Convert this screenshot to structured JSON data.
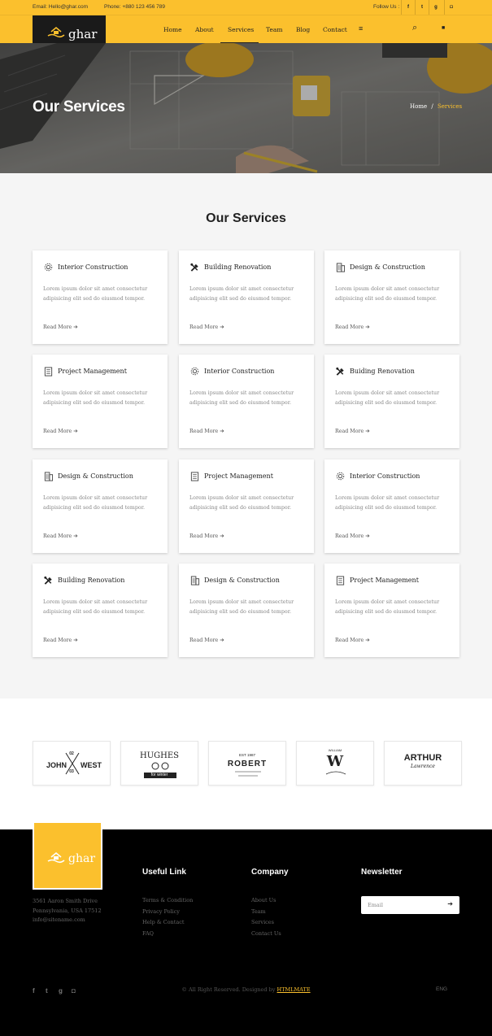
{
  "topbar": {
    "email": "Email: Hello@ghar.com",
    "phone": "Phone: +880 123 456 789",
    "follow": "Follow Us :",
    "social": [
      {
        "icon": "facebook-icon",
        "glyph": "f"
      },
      {
        "icon": "twitter-icon",
        "glyph": "t"
      },
      {
        "icon": "google-plus-icon",
        "glyph": "g"
      },
      {
        "icon": "instagram-icon",
        "glyph": "◘"
      }
    ]
  },
  "brand": {
    "name": "ghar"
  },
  "nav": {
    "items": [
      "Home",
      "About",
      "Services",
      "Team",
      "Blog",
      "Contact"
    ],
    "active": "Services",
    "menu_glyph": "≡",
    "search_glyph": "⌕",
    "chat_glyph": "■"
  },
  "hero": {
    "title": "Our Services",
    "breadcrumb_home": "Home",
    "breadcrumb_sep": "/",
    "breadcrumb_current": "Services"
  },
  "services": {
    "title": "Our Services",
    "cards": [
      {
        "icon": "gear-icon",
        "title": "Interior Construction"
      },
      {
        "icon": "tools-icon",
        "title": "Building Renovation"
      },
      {
        "icon": "building-icon",
        "title": "Design & Construction"
      },
      {
        "icon": "document-icon",
        "title": "Project Management"
      },
      {
        "icon": "gear-icon",
        "title": "Interior Construction"
      },
      {
        "icon": "tools-icon",
        "title": "Buiding Renovation"
      },
      {
        "icon": "building-icon",
        "title": "Design & Construction"
      },
      {
        "icon": "document-icon",
        "title": "Project Management"
      },
      {
        "icon": "gear-icon",
        "title": "Interior Construction"
      },
      {
        "icon": "tools-icon",
        "title": "Building Renovation"
      },
      {
        "icon": "building-icon",
        "title": "Design & Construction"
      },
      {
        "icon": "document-icon",
        "title": "Project Management"
      }
    ],
    "description": "Lorem ipsum dolor sit amet consectetur adipisicing elit sed do eiusmod tempor.",
    "read_more": "Read More ➔"
  },
  "clients": [
    {
      "name": "JOHN WEST",
      "left": "JOHN",
      "right": "WEST",
      "top": "02",
      "bottom": "03"
    },
    {
      "name": "HUGHES",
      "sub": "for winter"
    },
    {
      "name": "ROBERT",
      "top": "EST 1987"
    },
    {
      "name": "W",
      "top": "WILLIAM"
    },
    {
      "name": "ARTHUR",
      "sub": "Lawrence"
    }
  ],
  "footer": {
    "address": [
      "3561 Aaron Smith Drive",
      "Pennsylvania, USA 17512",
      "info@sitename.com"
    ],
    "useful_title": "Useful Link",
    "useful_links": [
      "Terms & Condition",
      "Privacy Policy",
      "Help & Contact",
      "FAQ"
    ],
    "company_title": "Company",
    "company_links": [
      "About Us",
      "Team",
      "Services",
      "Contact Us"
    ],
    "newsletter_title": "Newsletter",
    "email_placeholder": "Email",
    "submit_glyph": "➔",
    "social": [
      "f",
      "t",
      "g",
      "◘"
    ],
    "copyright": "© All Right Reserved. Designed by",
    "designer": "HTMLMATE",
    "language": "ENG"
  },
  "colors": {
    "accent": "#fbc02d",
    "dark": "#1a1a1a",
    "footer": "#000000",
    "section_bg": "#f5f5f5"
  }
}
